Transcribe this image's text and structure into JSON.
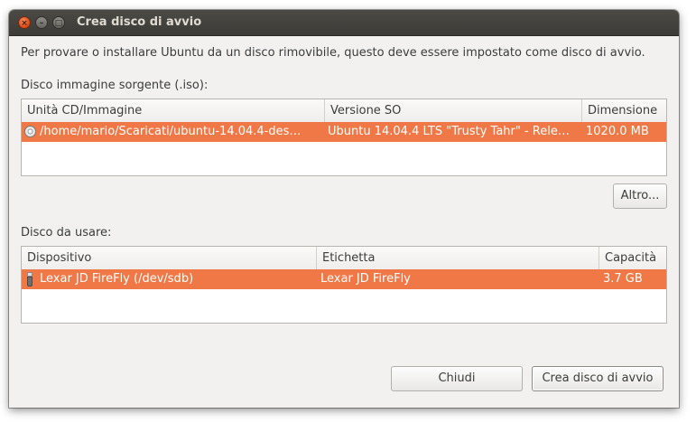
{
  "window": {
    "title": "Crea disco di avvio",
    "controls": {
      "close": "×",
      "minimize": "–",
      "maximize": "□"
    }
  },
  "intro_text": "Per provare o installare Ubuntu da un disco rimovibile, questo deve essere impostato come disco di avvio.",
  "source": {
    "label": "Disco immagine sorgente (.iso):",
    "columns": [
      "Unità CD/Immagine",
      "Versione SO",
      "Dimensione"
    ],
    "rows": [
      {
        "icon": "disc-icon",
        "path": "/home/mario/Scaricati/ubuntu-14.04.4-des…",
        "version": "Ubuntu 14.04.4 LTS \"Trusty Tahr\" - Rele…",
        "size": "1020.0 MB",
        "selected": true
      }
    ],
    "other_button": "Altro..."
  },
  "target": {
    "label": "Disco da usare:",
    "columns": [
      "Dispositivo",
      "Etichetta",
      "Capacità"
    ],
    "rows": [
      {
        "icon": "usb-drive-icon",
        "device": "Lexar JD FireFly (/dev/sdb)",
        "label": "Lexar JD FireFly",
        "capacity": "3.7 GB",
        "selected": true
      }
    ]
  },
  "buttons": {
    "close": "Chiudi",
    "create": "Crea disco di avvio"
  },
  "colors": {
    "selection": "#f07746",
    "titlebar": "#3c3b37",
    "window_bg": "#f2f1f0",
    "close_button": "#dd4814"
  }
}
